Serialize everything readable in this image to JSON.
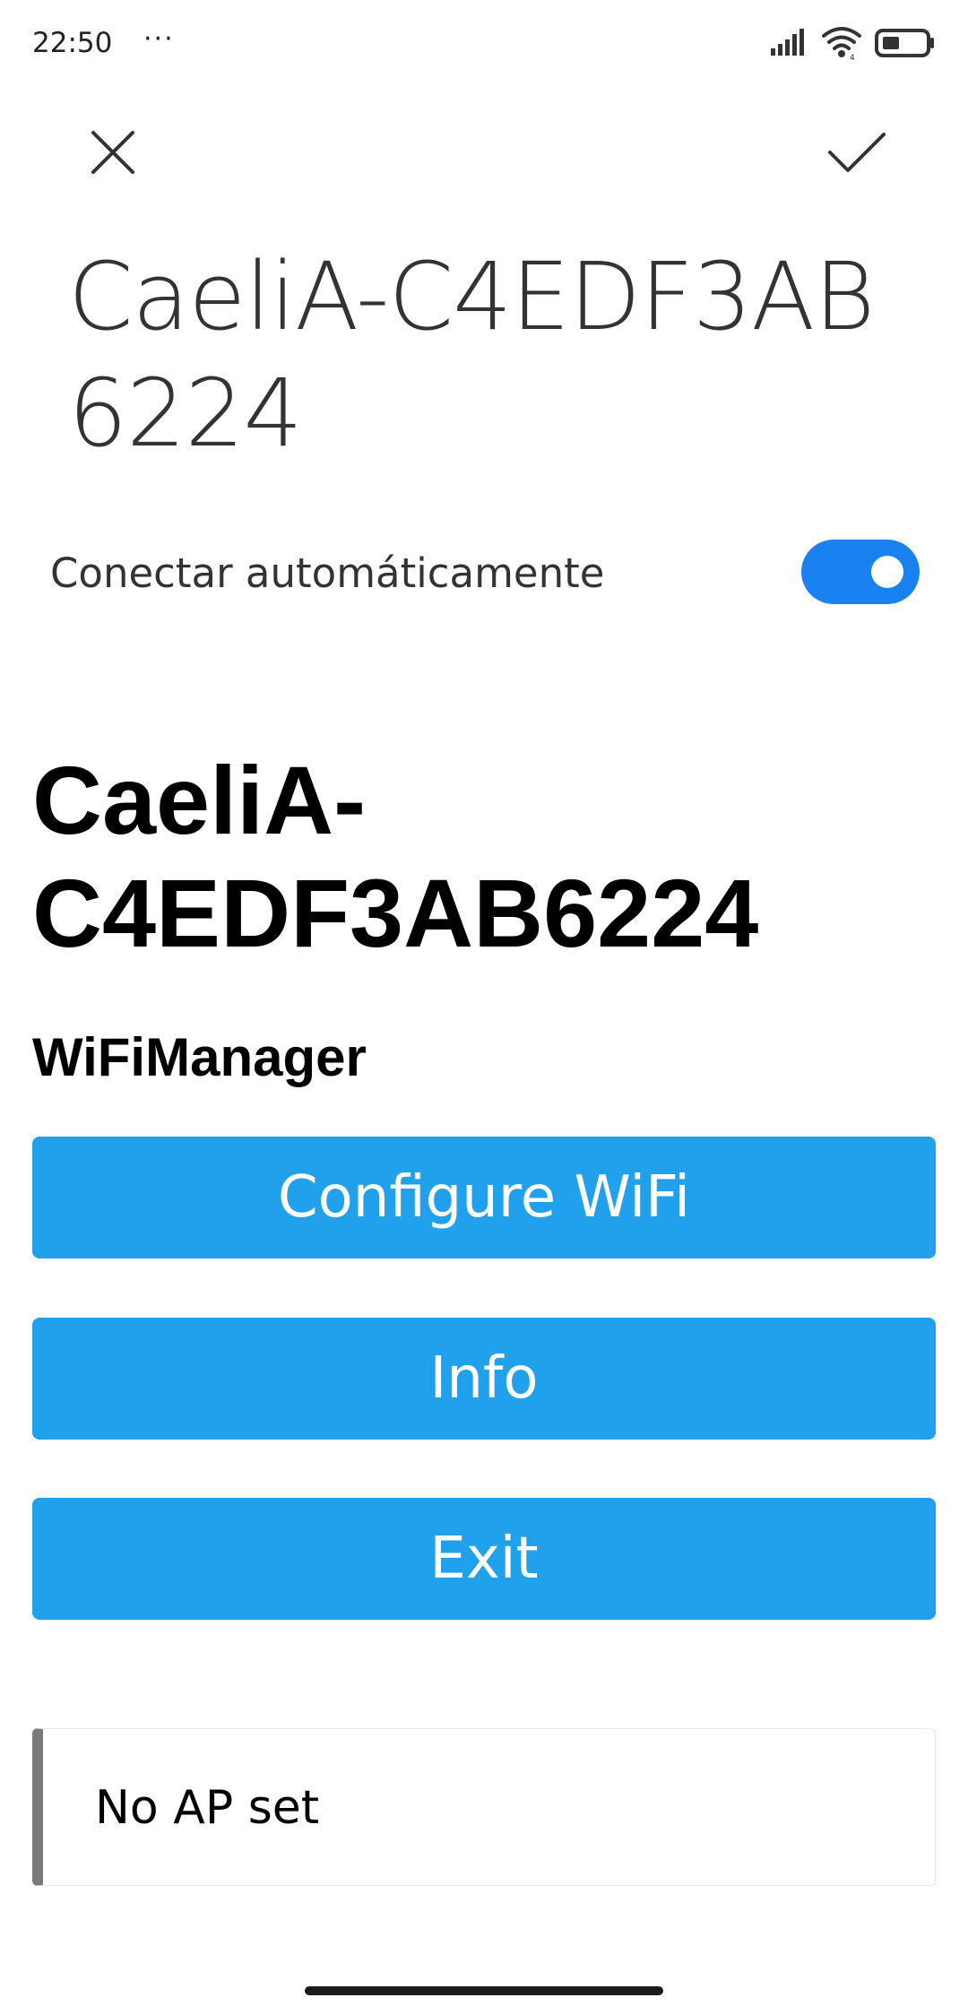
{
  "status_bar": {
    "time": "22:50",
    "more": "···",
    "icons": [
      "signal-icon",
      "wifi-icon",
      "battery-icon"
    ]
  },
  "toolbar": {
    "close_icon": "close-icon",
    "confirm_icon": "check-icon"
  },
  "network": {
    "ssid": "CaeliA-C4EDF3AB6224"
  },
  "auto_connect": {
    "label": "Conectar automáticamente",
    "enabled": true
  },
  "portal": {
    "title": "CaeliA-C4EDF3AB6224",
    "subtitle": "WiFiManager",
    "buttons": [
      {
        "label": "Configure WiFi"
      },
      {
        "label": "Info"
      },
      {
        "label": "Exit"
      }
    ],
    "message": "No AP set"
  },
  "colors": {
    "button": "#21a1ec",
    "toggle": "#1a82f0",
    "message_border": "#7a7a7a"
  }
}
